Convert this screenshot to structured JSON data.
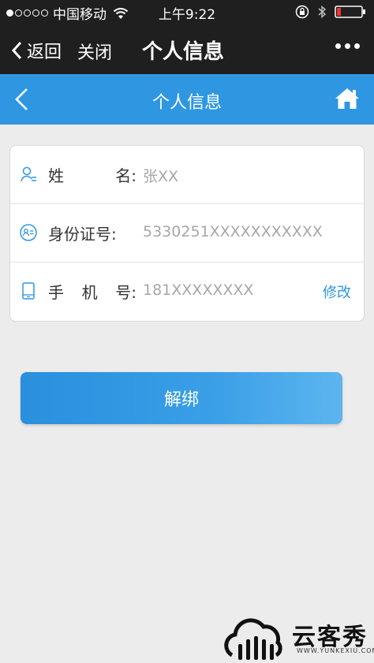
{
  "status_bar": {
    "carrier": "中国移动",
    "time": "上午9:22",
    "signal_icon": "signal-dots-icon",
    "wifi_icon": "wifi-icon",
    "bluetooth_icon": "bluetooth-icon",
    "battery_icon": "battery-low-icon"
  },
  "wx_bar": {
    "back_label": "返回",
    "close_label": "关闭",
    "title": "个人信息",
    "more_icon": "more-dots-icon"
  },
  "app_header": {
    "title": "个人信息",
    "back_icon": "chevron-left-icon",
    "home_icon": "home-icon",
    "color": "#2f97e2"
  },
  "info": {
    "name": {
      "label_part1": "姓",
      "label_part2": "名:",
      "value": "张XX",
      "icon": "user-icon"
    },
    "id_card": {
      "label": "身份证号:",
      "value": "5330251XXXXXXXXXXX",
      "icon": "id-card-icon"
    },
    "phone": {
      "label_part1": "手",
      "label_part2": "机",
      "label_part3": "号:",
      "value": "181XXXXXXXX",
      "edit_label": "修改",
      "icon": "phone-icon"
    }
  },
  "unbind_button": {
    "label": "解绑"
  },
  "watermark": {
    "text": "云客秀",
    "subtext": "WWW.YUNKEXIU.COM",
    "icon": "cloud-logo-icon"
  }
}
